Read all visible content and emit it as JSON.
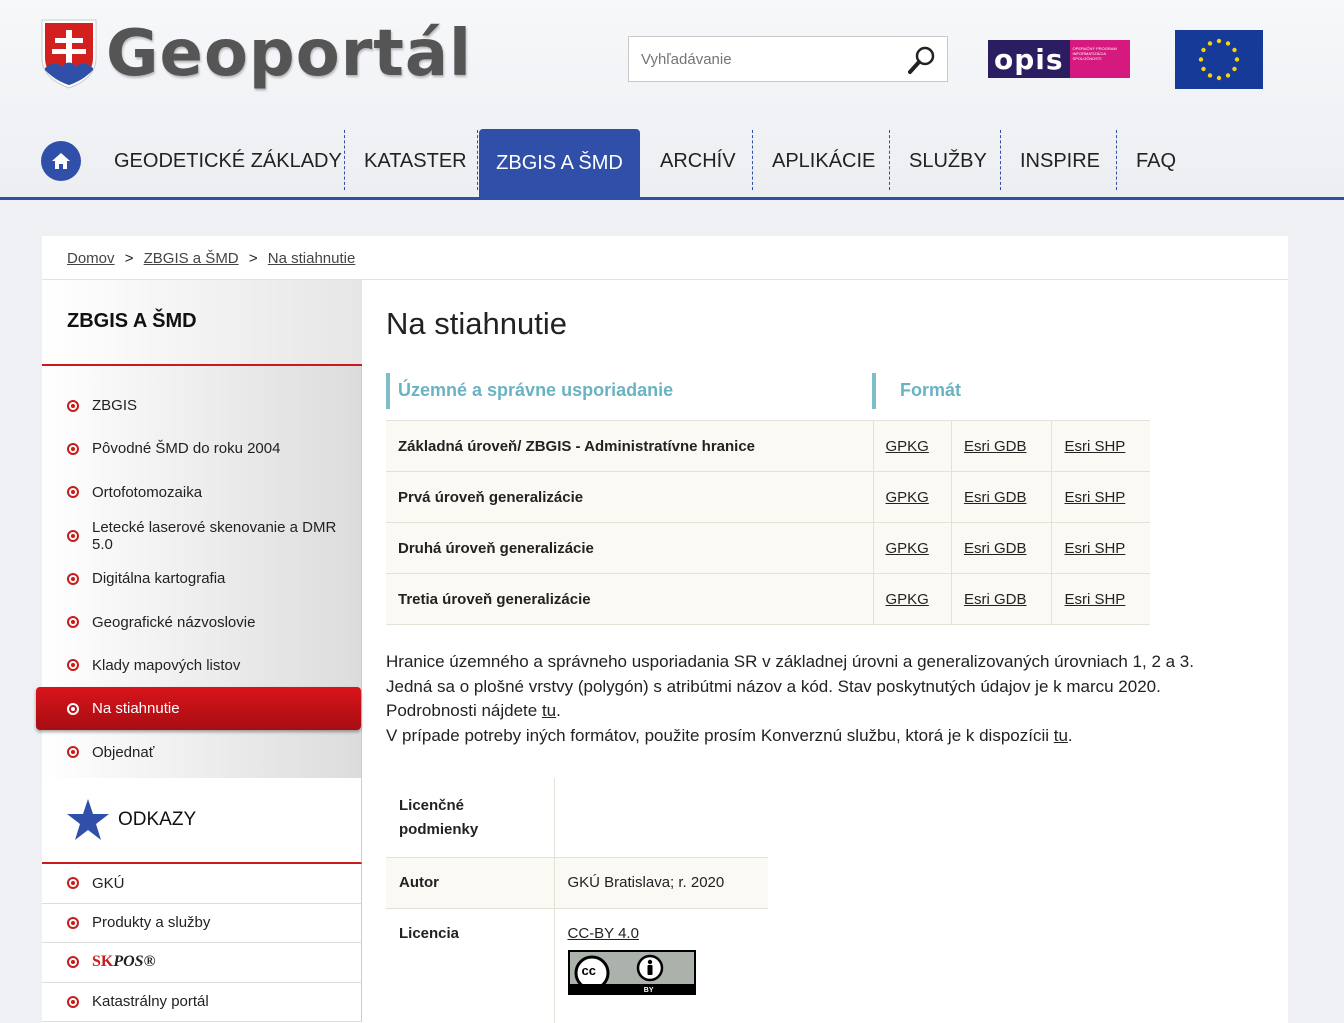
{
  "header": {
    "logo_text": "Geoportál",
    "search_placeholder": "Vyhľadávanie",
    "opis_label": "opis",
    "opis_sub": "OPERAČNÝ PROGRAM INFORMATIZÁCIA SPOLOČNOSTI"
  },
  "nav": {
    "items": [
      {
        "label": "GEODETICKÉ ZÁKLADY"
      },
      {
        "label": "KATASTER"
      },
      {
        "label": "ZBGIS A ŠMD"
      },
      {
        "label": "ARCHÍV"
      },
      {
        "label": "APLIKÁCIE"
      },
      {
        "label": "SLUŽBY"
      },
      {
        "label": "INSPIRE"
      },
      {
        "label": "FAQ"
      }
    ],
    "active_index": 2
  },
  "breadcrumb": {
    "items": [
      "Domov",
      "ZBGIS a ŠMD",
      "Na stiahnutie"
    ],
    "separator": ">"
  },
  "sidebar": {
    "title": "ZBGIS A ŠMD",
    "items": [
      {
        "label": "ZBGIS"
      },
      {
        "label": "Pôvodné ŠMD do roku 2004"
      },
      {
        "label": "Ortofotomozaika"
      },
      {
        "label": "Letecké laserové skenovanie a DMR 5.0"
      },
      {
        "label": "Digitálna kartografia"
      },
      {
        "label": "Geografické názvoslovie"
      },
      {
        "label": "Klady mapových listov"
      },
      {
        "label": "Na stiahnutie"
      },
      {
        "label": "Objednať"
      }
    ],
    "active_index": 7,
    "odkazy_title": "ODKAZY",
    "odkazy": [
      {
        "label": "GKÚ"
      },
      {
        "label": "Produkty a služby"
      },
      {
        "label_sk": "SK",
        "label_rest": "POS®"
      },
      {
        "label": "Katastrálny portál"
      }
    ]
  },
  "main": {
    "title": "Na stiahnutie",
    "col_title": "Územné a správne usporiadanie",
    "col_format": "Formát",
    "rows": [
      {
        "name": "Základná úroveň/ ZBGIS - Administratívne hranice",
        "f1": "GPKG",
        "f2": "Esri GDB",
        "f3": "Esri SHP"
      },
      {
        "name": "Prvá úroveň generalizácie",
        "f1": "GPKG",
        "f2": "Esri GDB",
        "f3": "Esri SHP"
      },
      {
        "name": "Druhá úroveň generalizácie",
        "f1": "GPKG",
        "f2": "Esri GDB",
        "f3": "Esri SHP"
      },
      {
        "name": "Tretia úroveň generalizácie",
        "f1": "GPKG",
        "f2": "Esri GDB",
        "f3": "Esri SHP"
      }
    ],
    "desc_line1": "Hranice územného a správneho usporiadania SR v základnej úrovni a generalizovaných úrovniach 1, 2 a 3.",
    "desc_line2": "Jedná sa o plošné vrstvy (polygón) s atribútmi názov a kód. Stav poskytnutých údajov je k marcu 2020.",
    "desc_line3_pre": "Podrobnosti nájdete ",
    "desc_line3_link": "tu",
    "desc_line3_post": ".",
    "desc_line4_pre": "V prípade potreby iných formátov, použite prosím Konverznú službu, ktorá je k dispozícii ",
    "desc_line4_link": "tu",
    "desc_line4_post": ".",
    "license": {
      "header": "Licenčné podmienky",
      "autor_label": "Autor",
      "autor_value": "GKÚ Bratislava; r. 2020",
      "licencia_label": "Licencia",
      "licencia_link": "CC-BY 4.0",
      "badge_by": "BY"
    }
  }
}
